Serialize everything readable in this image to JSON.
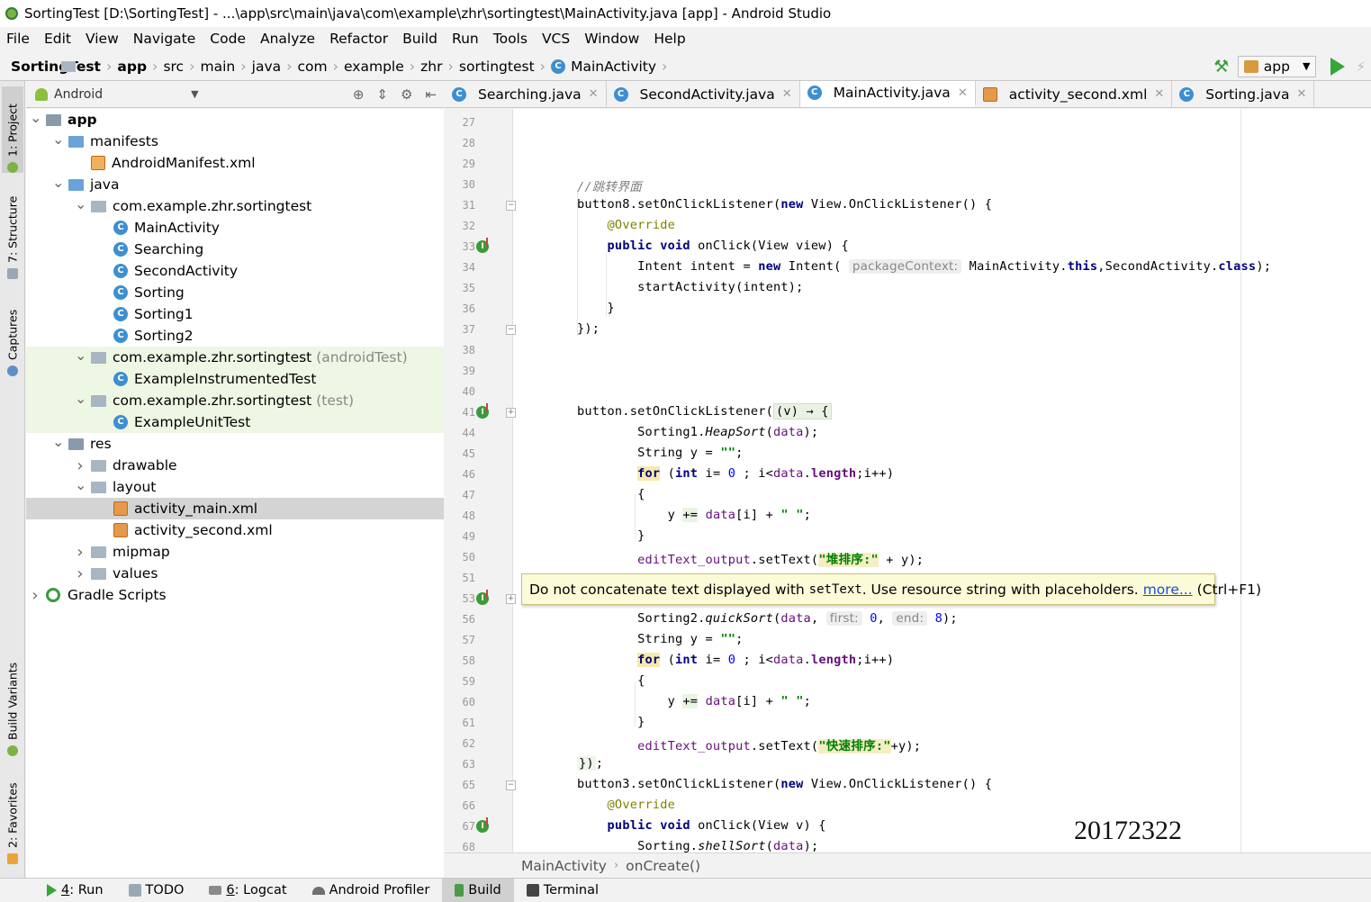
{
  "window": {
    "title": "SortingTest [D:\\SortingTest] - ...\\app\\src\\main\\java\\com\\example\\zhr\\sortingtest\\MainActivity.java [app] - Android Studio"
  },
  "menu": [
    "File",
    "Edit",
    "View",
    "Navigate",
    "Code",
    "Analyze",
    "Refactor",
    "Build",
    "Run",
    "Tools",
    "VCS",
    "Window",
    "Help"
  ],
  "breadcrumbs": [
    "SortingTest",
    "app",
    "src",
    "main",
    "java",
    "com",
    "example",
    "zhr",
    "sortingtest",
    "MainActivity"
  ],
  "run_config": "app",
  "project_panel": {
    "view_mode": "Android",
    "tree": [
      {
        "label": "app",
        "suffix": "",
        "depth": 0,
        "arrow": "down",
        "icon": "module-folder",
        "bold": true,
        "state": ""
      },
      {
        "label": "manifests",
        "suffix": "",
        "depth": 1,
        "arrow": "down",
        "icon": "folder",
        "bold": false,
        "state": ""
      },
      {
        "label": "AndroidManifest.xml",
        "suffix": "",
        "depth": 2,
        "arrow": "",
        "icon": "manifest",
        "bold": false,
        "state": ""
      },
      {
        "label": "java",
        "suffix": "",
        "depth": 1,
        "arrow": "down",
        "icon": "folder",
        "bold": false,
        "state": ""
      },
      {
        "label": "com.example.zhr.sortingtest",
        "suffix": "",
        "depth": 2,
        "arrow": "down",
        "icon": "package",
        "bold": false,
        "state": ""
      },
      {
        "label": "MainActivity",
        "suffix": "",
        "depth": 3,
        "arrow": "",
        "icon": "class",
        "bold": false,
        "state": ""
      },
      {
        "label": "Searching",
        "suffix": "",
        "depth": 3,
        "arrow": "",
        "icon": "class",
        "bold": false,
        "state": ""
      },
      {
        "label": "SecondActivity",
        "suffix": "",
        "depth": 3,
        "arrow": "",
        "icon": "class",
        "bold": false,
        "state": ""
      },
      {
        "label": "Sorting",
        "suffix": "",
        "depth": 3,
        "arrow": "",
        "icon": "class",
        "bold": false,
        "state": ""
      },
      {
        "label": "Sorting1",
        "suffix": "",
        "depth": 3,
        "arrow": "",
        "icon": "class",
        "bold": false,
        "state": ""
      },
      {
        "label": "Sorting2",
        "suffix": "",
        "depth": 3,
        "arrow": "",
        "icon": "class",
        "bold": false,
        "state": ""
      },
      {
        "label": "com.example.zhr.sortingtest",
        "suffix": " (androidTest)",
        "depth": 2,
        "arrow": "down",
        "icon": "package",
        "bold": false,
        "state": "test"
      },
      {
        "label": "ExampleInstrumentedTest",
        "suffix": "",
        "depth": 3,
        "arrow": "",
        "icon": "class",
        "bold": false,
        "state": "test"
      },
      {
        "label": "com.example.zhr.sortingtest",
        "suffix": " (test)",
        "depth": 2,
        "arrow": "down",
        "icon": "package",
        "bold": false,
        "state": "test"
      },
      {
        "label": "ExampleUnitTest",
        "suffix": "",
        "depth": 3,
        "arrow": "",
        "icon": "class",
        "bold": false,
        "state": "test"
      },
      {
        "label": "res",
        "suffix": "",
        "depth": 1,
        "arrow": "down",
        "icon": "res-folder",
        "bold": false,
        "state": ""
      },
      {
        "label": "drawable",
        "suffix": "",
        "depth": 2,
        "arrow": "right",
        "icon": "package",
        "bold": false,
        "state": ""
      },
      {
        "label": "layout",
        "suffix": "",
        "depth": 2,
        "arrow": "down",
        "icon": "package",
        "bold": false,
        "state": ""
      },
      {
        "label": "activity_main.xml",
        "suffix": "",
        "depth": 3,
        "arrow": "",
        "icon": "xml",
        "bold": false,
        "state": "selected"
      },
      {
        "label": "activity_second.xml",
        "suffix": "",
        "depth": 3,
        "arrow": "",
        "icon": "xml",
        "bold": false,
        "state": ""
      },
      {
        "label": "mipmap",
        "suffix": "",
        "depth": 2,
        "arrow": "right",
        "icon": "package",
        "bold": false,
        "state": ""
      },
      {
        "label": "values",
        "suffix": "",
        "depth": 2,
        "arrow": "right",
        "icon": "package",
        "bold": false,
        "state": ""
      },
      {
        "label": "Gradle Scripts",
        "suffix": "",
        "depth": 0,
        "arrow": "right",
        "icon": "gradle",
        "bold": false,
        "state": ""
      }
    ]
  },
  "left_tool_windows": [
    "1: Project",
    "7: Structure",
    "Captures",
    "Build Variants",
    "2: Favorites"
  ],
  "editor_tabs": [
    {
      "label": "Searching.java",
      "icon": "class",
      "active": false
    },
    {
      "label": "SecondActivity.java",
      "icon": "class",
      "active": false
    },
    {
      "label": "MainActivity.java",
      "icon": "class",
      "active": true
    },
    {
      "label": "activity_second.xml",
      "icon": "xml",
      "active": false
    },
    {
      "label": "Sorting.java",
      "icon": "class",
      "active": false
    }
  ],
  "code": {
    "line_numbers": [
      "27",
      "28",
      "29",
      "30",
      "31",
      "32",
      "33",
      "34",
      "35",
      "36",
      "37",
      "38",
      "39",
      "40",
      "41",
      "44",
      "45",
      "46",
      "47",
      "48",
      "49",
      "50",
      "51",
      "53",
      "56",
      "57",
      "58",
      "59",
      "60",
      "61",
      "62",
      "63",
      "65",
      "66",
      "67",
      "68"
    ],
    "comment_30": "//跳转界面",
    "str_heap": "\"堆排序:\"",
    "str_quick": "\"快速排序:\"",
    "hint_context": "packageContext:",
    "hint_first": "first:",
    "hint_end": "end:"
  },
  "tooltip": {
    "pre": "Do not concatenate text displayed with",
    "code": "setText",
    "post": ". Use resource string with placeholders.",
    "link": "more...",
    "shortcut": "(Ctrl+F1)"
  },
  "watermark": "20172322",
  "editor_breadcrumb": [
    "MainActivity",
    "onCreate()"
  ],
  "bottom_tools": [
    {
      "mnemonic": "4",
      "label": ": Run"
    },
    {
      "mnemonic": "",
      "label": "TODO"
    },
    {
      "mnemonic": "6",
      "label": ": Logcat"
    },
    {
      "mnemonic": "",
      "label": "Android Profiler"
    },
    {
      "mnemonic": "",
      "label": "Build"
    },
    {
      "mnemonic": "",
      "label": "Terminal"
    }
  ]
}
